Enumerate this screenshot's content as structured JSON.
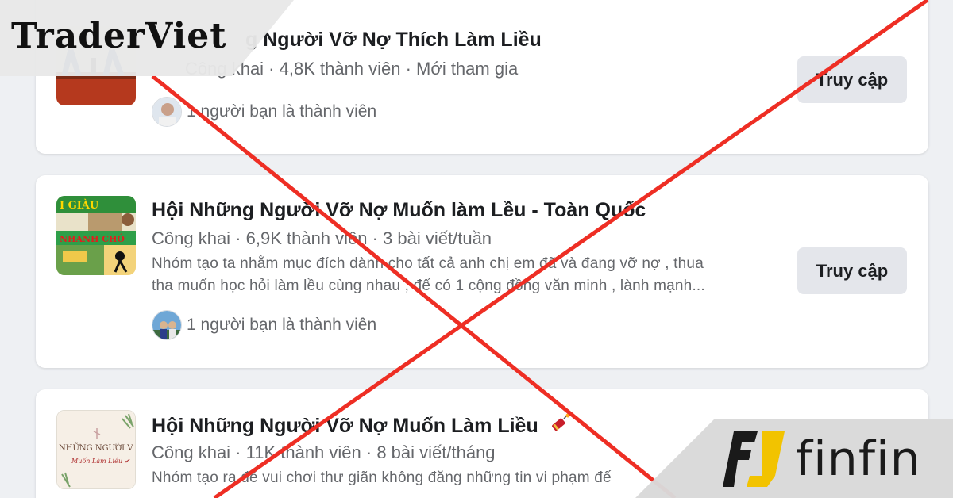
{
  "colors": {
    "page_bg": "#eef0f3",
    "card_bg": "#ffffff",
    "button_bg": "#e4e6eb",
    "cross": "#ee2e24",
    "finfin_accent": "#f2c300"
  },
  "groups": [
    {
      "title": "Hội Những Người Vỡ Nợ Thích Làm Liều",
      "title_visible": "g Người Vỡ Nợ Thích Làm Liều",
      "meta": "Công khai · 4,8K thành viên · Mới tham gia",
      "meta_visible": "Công khai · 4,8K thành viên · Mới tham gia",
      "friends": "1 người bạn là thành viên",
      "button": "Truy cập"
    },
    {
      "title": "Hội Những Người Vỡ Nợ Muốn làm Lều - Toàn Quốc",
      "meta": "Công khai · 6,9K thành viên · 3 bài viết/tuần",
      "desc_line1": "Nhóm tạo ta nhằm mục đích dành cho tất cả anh chị em đã và đang vỡ nợ , thua",
      "desc_line2": "tha muốn học hỏi làm lều cùng nhau , để có 1 cộng đồng văn minh , lành mạnh...",
      "thumb_text_1": "I GIÀU",
      "thumb_text_2": "NHANH CHÓ",
      "friends": "1 người bạn là thành viên",
      "button": "Truy cập"
    },
    {
      "title": "Hội Những Người Vỡ Nợ Muốn Làm Liều",
      "title_icon": "firecracker-icon",
      "meta": "Công khai · 11K thành viên · 8 bài viết/tháng",
      "desc_line1": "Nhóm tạo ra để vui chơi thư giãn không đăng những tin vi phạm đế",
      "thumb_text_1": "NHỮNG NGƯỜI V",
      "thumb_text_2": "Muốn Làm Liều ✔"
    }
  ],
  "brand_left": "TraderViet",
  "brand_right": "finfin"
}
